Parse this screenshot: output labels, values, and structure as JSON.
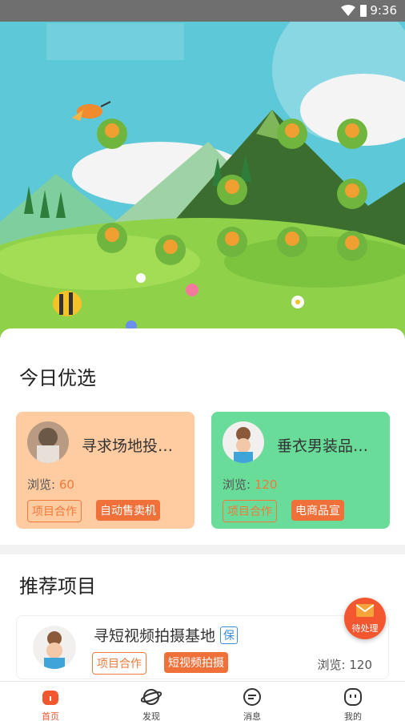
{
  "status_bar": {
    "time": "9:36"
  },
  "today_section": {
    "title": "今日优选",
    "cards": [
      {
        "title": "寻求场地投…",
        "views_label": "浏览: ",
        "views": "60",
        "tag_outline": "项目合作",
        "tag_fill": "自动售卖机"
      },
      {
        "title": "垂衣男装品…",
        "views_label": "浏览: ",
        "views": "120",
        "tag_outline": "项目合作",
        "tag_fill": "电商品宣"
      }
    ]
  },
  "recommend_section": {
    "title": "推荐项目",
    "project": {
      "title": "寻短视频拍摄基地",
      "badge": "保",
      "tag_outline": "项目合作",
      "tag_fill": "短视频拍摄",
      "views": "浏览: 120"
    }
  },
  "pending_button": {
    "label": "待处理"
  },
  "tab_bar": {
    "tabs": [
      {
        "label": "首页",
        "icon": "home-icon"
      },
      {
        "label": "发现",
        "icon": "discover-icon"
      },
      {
        "label": "消息",
        "icon": "message-icon"
      },
      {
        "label": "我的",
        "icon": "profile-icon"
      }
    ]
  },
  "colors": {
    "accent": "#f2572f",
    "card_left": "#ffcba1",
    "card_right": "#69dc9a",
    "sky": "#5dc8d8",
    "grass": "#8fd24a"
  }
}
